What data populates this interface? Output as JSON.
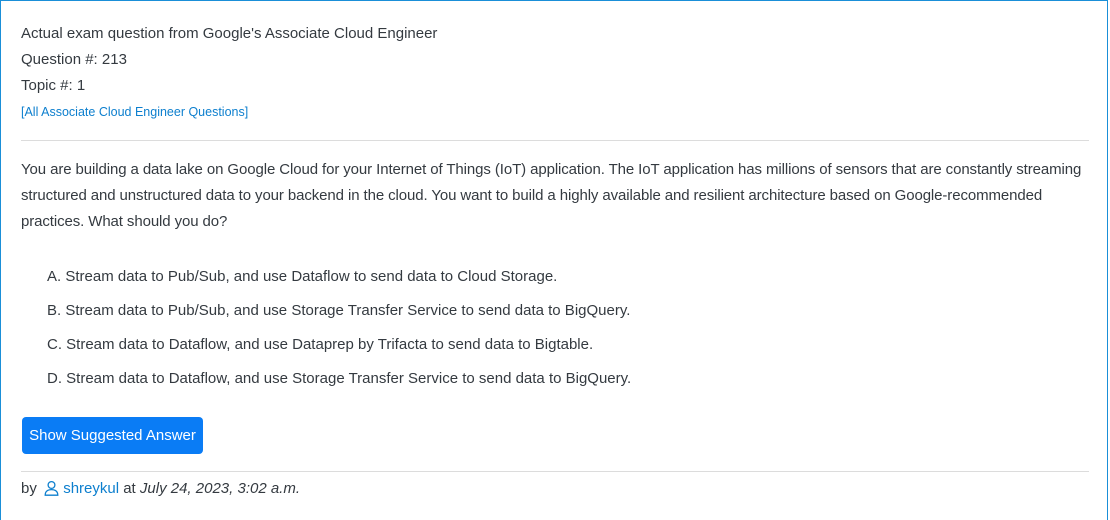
{
  "header": {
    "source_line": "Actual exam question from Google's Associate Cloud Engineer",
    "question_number": "Question #: 213",
    "topic_number": "Topic #: 1",
    "all_questions_link": "[All Associate Cloud Engineer Questions]"
  },
  "question": {
    "text": "You are building a data lake on Google Cloud for your Internet of Things (IoT) application. The IoT application has millions of sensors that are constantly streaming structured and unstructured data to your backend in the cloud. You want to build a highly available and resilient architecture based on Google-recommended practices. What should you do?",
    "choices": [
      "A. Stream data to Pub/Sub, and use Dataflow to send data to Cloud Storage.",
      "B. Stream data to Pub/Sub, and use Storage Transfer Service to send data to BigQuery.",
      "C. Stream data to Dataflow, and use Dataprep by Trifacta to send data to Bigtable.",
      "D. Stream data to Dataflow, and use Storage Transfer Service to send data to BigQuery."
    ]
  },
  "actions": {
    "show_answer_label": "Show Suggested Answer"
  },
  "meta": {
    "by_label": "by",
    "user_icon": "user-icon",
    "username": "shreykul",
    "at_label": "at",
    "date": "July 24, 2023, 3:02 a.m."
  },
  "colors": {
    "accent": "#0a7cf5",
    "link": "#0d7fce",
    "border": "#1a8fd8",
    "text": "#343a40"
  }
}
